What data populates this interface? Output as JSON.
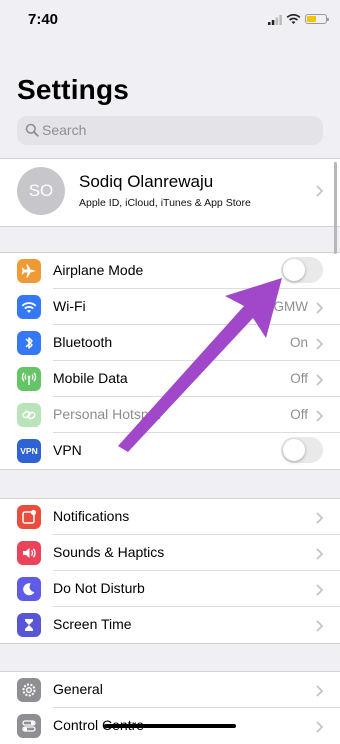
{
  "status_bar": {
    "time": "7:40"
  },
  "header": {
    "title": "Settings"
  },
  "search": {
    "placeholder": "Search"
  },
  "profile": {
    "initials": "SO",
    "name": "Sodiq Olanrewaju",
    "subtitle": "Apple ID, iCloud, iTunes & App Store"
  },
  "connectivity": {
    "airplane": {
      "label": "Airplane Mode",
      "on": false
    },
    "wifi": {
      "label": "Wi-Fi",
      "value": "GMW"
    },
    "bluetooth": {
      "label": "Bluetooth",
      "value": "On"
    },
    "mobile_data": {
      "label": "Mobile Data",
      "value": "Off"
    },
    "hotspot": {
      "label": "Personal Hotspot",
      "value": "Off"
    },
    "vpn": {
      "label": "VPN",
      "icon_text": "VPN",
      "on": false
    }
  },
  "alerts": {
    "notifications": {
      "label": "Notifications"
    },
    "sounds": {
      "label": "Sounds & Haptics"
    },
    "dnd": {
      "label": "Do Not Disturb"
    },
    "screen_time": {
      "label": "Screen Time"
    }
  },
  "system": {
    "general": {
      "label": "General"
    },
    "control_centre": {
      "label": "Control Centre"
    }
  },
  "colors": {
    "airplane": "#f09a37",
    "wifi": "#3478f6",
    "bluetooth": "#3478f6",
    "mobile_data": "#65c466",
    "hotspot": "#65c466",
    "vpn": "#2f62d2",
    "notifications": "#eb4d3d",
    "sounds": "#eb445a",
    "dnd": "#5e5ce6",
    "screen_time": "#5856d6",
    "general": "#8e8e93",
    "control_centre": "#8e8e93",
    "annotation_arrow": "#a147c9"
  }
}
